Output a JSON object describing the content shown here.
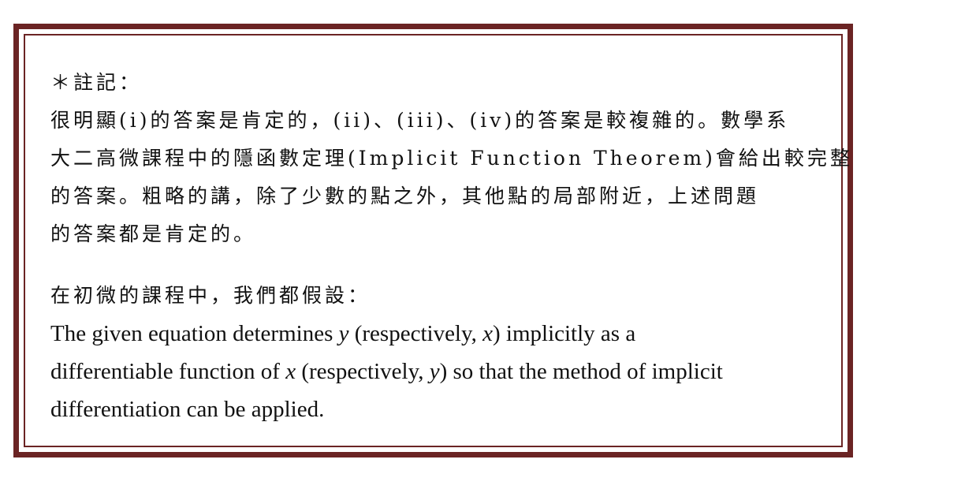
{
  "note": {
    "heading": "＊註記：",
    "paragraph1": {
      "lines": [
        "很明顯(i)的答案是肯定的，(ii)、(iii)、(iv)的答案是較複雜的。數學系",
        "大二高微課程中的隱函數定理(Implicit Function Theorem)會給出較完整",
        "的答案。粗略的講，除了少數的點之外，其他點的局部附近，上述問題",
        "的答案都是肯定的。"
      ]
    },
    "paragraph2": {
      "intro": "在初微的課程中，我們都假設：",
      "statement": {
        "line1_a": "The given equation determines ",
        "line1_var1": "y",
        "line1_b": " (respectively, ",
        "line1_var2": "x",
        "line1_c": ") implicitly as a",
        "line2_a": "differentiable function of ",
        "line2_var1": "x",
        "line2_b": " (respectively, ",
        "line2_var2": "y",
        "line2_c": ") so that the method of implicit",
        "line3": "differentiation can be applied."
      }
    }
  },
  "colors": {
    "border": "#6b2424",
    "text": "#111111"
  }
}
